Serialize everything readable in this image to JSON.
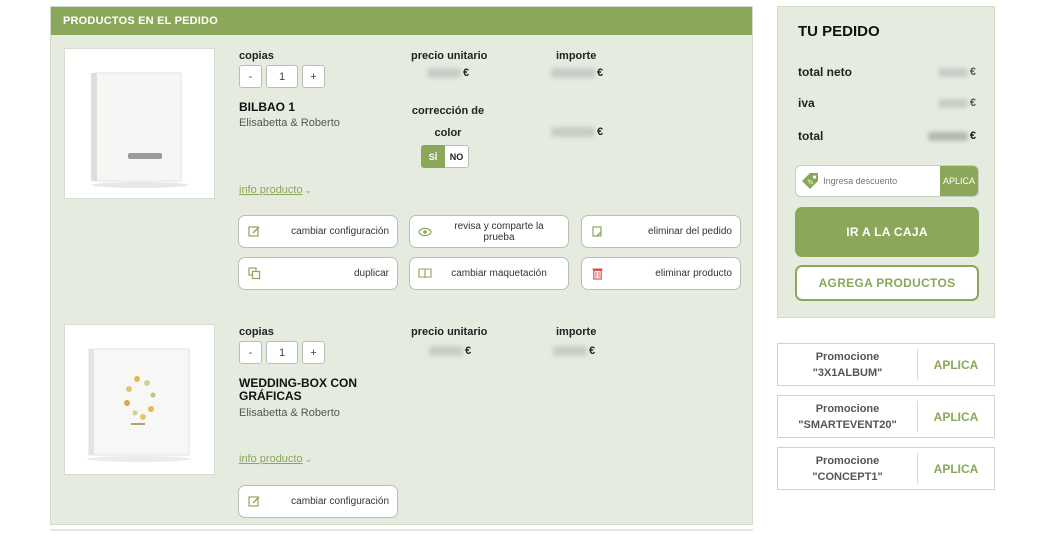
{
  "panel": {
    "title": "PRODUCTOS EN EL PEDIDO"
  },
  "labels": {
    "copies": "copias",
    "unit_price": "precio unitario",
    "amount": "importe",
    "color_correction": "corrección de color",
    "info": "info producto"
  },
  "products": [
    {
      "name": "BILBAO 1",
      "subtitle": "Elisabetta & Roberto",
      "qty": "1",
      "qty_minus": "-",
      "qty_plus": "+",
      "currency": "€",
      "toggle_yes": "SÍ",
      "toggle_no": "NO",
      "actions": [
        "cambiar configuración",
        "revisa y comparte la prueba",
        "eliminar del pedido",
        "duplicar",
        "cambiar maquetación",
        "eliminar producto"
      ]
    },
    {
      "name": "WEDDING-BOX CON GRÁFICAS",
      "subtitle": "Elisabetta & Roberto",
      "qty": "1",
      "qty_minus": "-",
      "qty_plus": "+",
      "currency": "€",
      "actions": [
        "cambiar configuración"
      ]
    }
  ],
  "order": {
    "title": "TU PEDIDO",
    "net_label": "total neto",
    "iva_label": "iva",
    "total_label": "total",
    "currency": "€",
    "discount_placeholder": "Ingresa descuento",
    "discount_apply": "APLICA",
    "checkout": "IR A LA CAJA",
    "add_products": "AGREGA PRODUCTOS"
  },
  "promos": [
    {
      "line1": "Promocione",
      "line2": "\"3X1ALBUM\"",
      "apply": "APLICA"
    },
    {
      "line1": "Promocione",
      "line2": "\"SMARTEVENT20\"",
      "apply": "APLICA"
    },
    {
      "line1": "Promocione",
      "line2": "\"CONCEPT1\"",
      "apply": "APLICA"
    }
  ],
  "colors": {
    "accent": "#8aa75a",
    "panel_bg": "#e6ebe0"
  }
}
